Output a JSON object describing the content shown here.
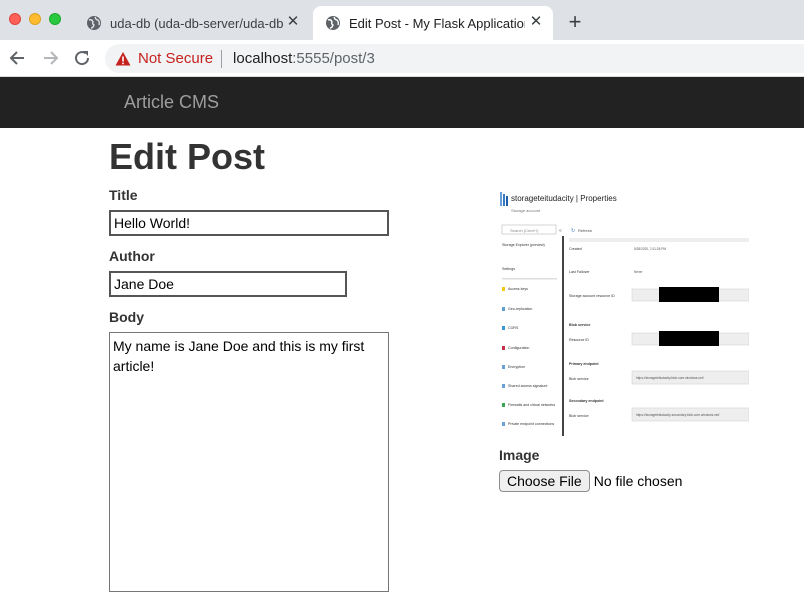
{
  "browser": {
    "tabs": [
      {
        "title": "uda-db (uda-db-server/uda-db",
        "active": false
      },
      {
        "title": "Edit Post - My Flask Application",
        "active": true
      }
    ],
    "address": {
      "security_label": "Not Secure",
      "host": "localhost",
      "rest": ":5555/post/3"
    }
  },
  "app": {
    "brand": "Article CMS"
  },
  "form": {
    "heading": "Edit Post",
    "title_label": "Title",
    "title_value": "Hello World!",
    "author_label": "Author",
    "author_value": "Jane Doe",
    "body_label": "Body",
    "body_value": "My name is Jane Doe and this is my first article!",
    "image_label": "Image",
    "file_button": "Choose File",
    "file_status": "No file chosen"
  },
  "image_preview": {
    "header": "storageteitudacity | Properties",
    "subheader": "Storage account",
    "search": "Search (Cmd+/)",
    "refresh": "Refresh",
    "menu": [
      "Storage Explorer (preview)",
      "Settings",
      "Access keys",
      "Geo-replication",
      "CORS",
      "Configuration",
      "Encryption",
      "Shared access signature",
      "Firewalls and virtual networks",
      "Private endpoint connections"
    ],
    "props": [
      "Created",
      "Last Failover",
      "Storage account resource ID",
      "Blob service",
      "Resource ID",
      "Primary endpoint",
      "Blob service",
      "Secondary endpoint",
      "Blob service"
    ],
    "values": [
      "5/28/2020, 2:11:28 PM",
      "Never",
      "https://storageteitudacity.blob.core.windows.net/",
      "https://storageteitudacity-secondary.blob.core.windows.net/"
    ]
  },
  "colors": {
    "navbar": "#222222",
    "brand_text": "#9d9d9d",
    "not_secure": "#c5221f"
  }
}
